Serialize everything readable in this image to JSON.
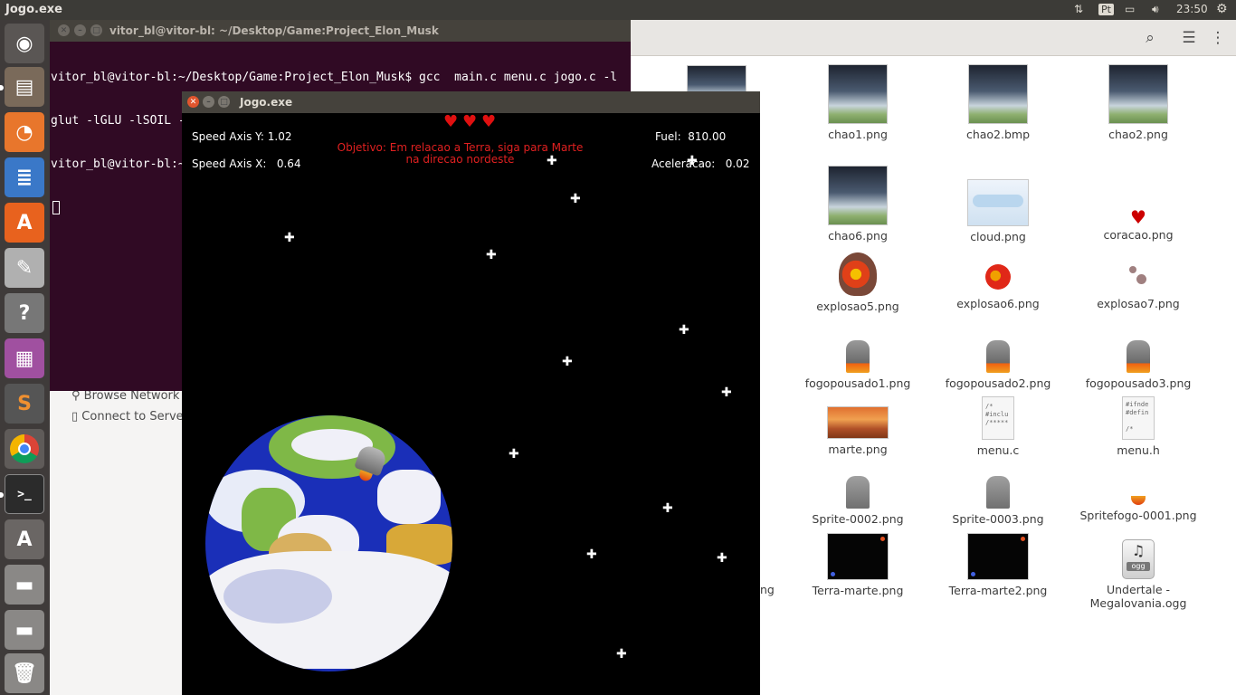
{
  "topbar": {
    "app_title": "Jogo.exe",
    "keyboard": "Pt",
    "time": "23:50"
  },
  "launcher": {
    "items": [
      "ubuntu-dash-icon",
      "files-icon",
      "firefox-icon",
      "libreoffice-writer-icon",
      "software-center-icon",
      "system-settings-icon",
      "help-icon",
      "workspace-icon",
      "sublime-text-icon",
      "chrome-icon",
      "terminal-icon",
      "software-updater-icon",
      "drive-icon",
      "drive-icon",
      "trash-icon"
    ]
  },
  "filemanager": {
    "sidebar": {
      "browse_network": "Browse Network",
      "connect_server": "Connect to Server"
    },
    "partial_label": "ng",
    "files": [
      {
        "name": "chao1.png"
      },
      {
        "name": "chao2.bmp"
      },
      {
        "name": "chao2.png"
      },
      {
        "name": "chao6.png"
      },
      {
        "name": "cloud.png"
      },
      {
        "name": "coracao.png"
      },
      {
        "name": "explosao5.png"
      },
      {
        "name": "explosao6.png"
      },
      {
        "name": "explosao7.png"
      },
      {
        "name": "fogopousado1.png"
      },
      {
        "name": "fogopousado2.png"
      },
      {
        "name": "fogopousado3.png"
      },
      {
        "name": "marte.png"
      },
      {
        "name": "menu.c"
      },
      {
        "name": "menu.h"
      },
      {
        "name": "Sprite-0002.png"
      },
      {
        "name": "Sprite-0003.png"
      },
      {
        "name": "Spritefogo-0001.png"
      },
      {
        "name": "Terra-marte.png"
      },
      {
        "name": "Terra-marte2.png"
      },
      {
        "name": "Undertale -\nMegalovania.ogg"
      }
    ],
    "menu_c_preview": "/*\n#inclu\n/*****",
    "menu_h_preview": "#ifnde\n#defin\n\n/*",
    "ogg_badge": "ogg"
  },
  "terminal": {
    "title": "vitor_bl@vitor-bl: ~/Desktop/Game:Project_Elon_Musk",
    "lines": [
      "vitor_bl@vitor-bl:~/Desktop/Game:Project_Elon_Musk$ gcc  main.c menu.c jogo.c -l",
      "glut -lGLU -lSOIL -lGLEW -lGL -lm -lSDL -lSDL_mixer",
      "vitor_bl@vitor-bl:~/Desktop/Game:Project_Elon_Musk$ ./a.out"
    ]
  },
  "game": {
    "title": "Jogo.exe",
    "lives": 3,
    "speed_y_label": "Speed Axis Y:",
    "speed_y": "1.02",
    "speed_x_label": "Speed Axis X:",
    "speed_x": "0.64",
    "fuel_label": "Fuel:",
    "fuel": "810.00",
    "accel_label": "Aceleracao:",
    "accel": "0.02",
    "objective_line1": "Objetivo: Em relacao a Terra, siga para Marte",
    "objective_line2": "na direcao nordeste",
    "colors": {
      "objective": "#e02020",
      "hearts": "#e01010",
      "terminal_bg": "#300a24",
      "topbar": "#3c3b37"
    }
  }
}
